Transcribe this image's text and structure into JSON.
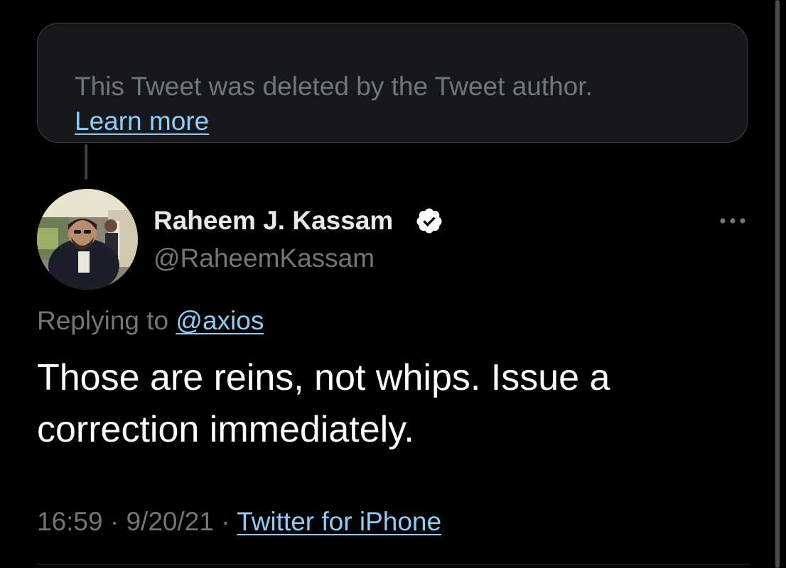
{
  "deleted_notice": {
    "text": "This Tweet was deleted by the Tweet author.",
    "learn_more": "Learn more"
  },
  "author": {
    "display_name": "Raheem J. Kassam",
    "handle": "@RaheemKassam",
    "verified": true,
    "avatar_icon": "profile-photo"
  },
  "reply": {
    "prefix": "Replying to ",
    "to": "@axios"
  },
  "tweet": {
    "text": "Those are reins, not whips. Issue a correction immediately."
  },
  "meta": {
    "time": "16:59",
    "separator": " · ",
    "date": "9/20/21",
    "source": "Twitter for iPhone"
  },
  "colors": {
    "background": "#000000",
    "link": "#8ecdf8",
    "secondary_text": "#71767b",
    "primary_text": "#ffffff",
    "card_background": "#16181c"
  },
  "icons": {
    "verified": "verified-badge-icon",
    "more": "more-options-icon"
  }
}
